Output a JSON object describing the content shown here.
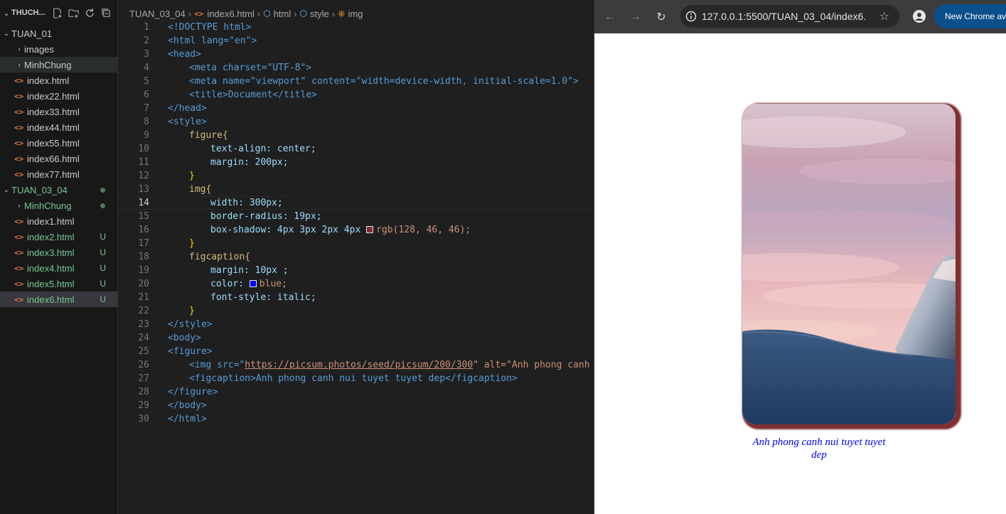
{
  "explorer": {
    "title": "THUCH...",
    "items": [
      {
        "label": "TUAN_01",
        "kind": "folder-open"
      },
      {
        "label": "images",
        "kind": "folder"
      },
      {
        "label": "MinhChung",
        "kind": "folder"
      },
      {
        "label": "index.html",
        "kind": "file"
      },
      {
        "label": "index22.html",
        "kind": "file"
      },
      {
        "label": "index33.html",
        "kind": "file"
      },
      {
        "label": "index44.html",
        "kind": "file"
      },
      {
        "label": "index55.html",
        "kind": "file"
      },
      {
        "label": "index66.html",
        "kind": "file"
      },
      {
        "label": "index77.html",
        "kind": "file"
      },
      {
        "label": "TUAN_03_04",
        "kind": "folder-open"
      },
      {
        "label": "MinhChung",
        "kind": "folder"
      },
      {
        "label": "index1.html",
        "kind": "file"
      },
      {
        "label": "index2.html",
        "kind": "file",
        "badge": "U"
      },
      {
        "label": "index3.html",
        "kind": "file",
        "badge": "U"
      },
      {
        "label": "index4.html",
        "kind": "file",
        "badge": "U"
      },
      {
        "label": "index5.html",
        "kind": "file",
        "badge": "U"
      },
      {
        "label": "index6.html",
        "kind": "file",
        "badge": "U"
      }
    ]
  },
  "breadcrumb": {
    "folder": "TUAN_03_04",
    "file": "index6.html",
    "n1": "html",
    "n2": "style",
    "n3": "img"
  },
  "code": {
    "lines": [
      "1",
      "2",
      "3",
      "4",
      "5",
      "6",
      "7",
      "8",
      "9",
      "10",
      "11",
      "12",
      "13",
      "14",
      "15",
      "16",
      "17",
      "18",
      "19",
      "20",
      "21",
      "22",
      "23",
      "24",
      "25",
      "26",
      "27",
      "28",
      "29",
      "30"
    ],
    "doctype": "<!DOCTYPE html>",
    "l2": "<html lang=\"en\">",
    "l3": "<head>",
    "l4": "<meta charset=\"UTF-8\">",
    "l5": "<meta name=\"viewport\" content=\"width=device-width, initial-scale=1.0\">",
    "l6": "<title>Document</title>",
    "l7": "</head>",
    "l8": "<style>",
    "l9": "figure{",
    "l10": "text-align: center;",
    "l11": "margin: 200px;",
    "l12": "}",
    "l13": "img{",
    "l14": "width: 300px;",
    "l15": "border-radius: 19px;",
    "l16a": "box-shadow: 4px 3px 2px 4px ",
    "l16b": "rgb(128, 46, 46);",
    "l17": "}",
    "l18": "figcaption{",
    "l19": "margin: 10px ;",
    "l20a": "color: ",
    "l20b": "blue;",
    "l21": "font-style: italic;",
    "l22": "}",
    "l23": "</style>",
    "l24": "<body>",
    "l25": "<figure>",
    "l26a": "<img src=\"",
    "l26url": "https://picsum.photos/seed/picsum/200/300",
    "l26b": "\" alt=\"Anh phong canh nu",
    "l27": "<figcaption>Anh phong canh nui tuyet tuyet dep</figcaption>",
    "l28": "</figure>",
    "l29": "</body>",
    "l30": "</html>"
  },
  "browser": {
    "url": "127.0.0.1:5500/TUAN_03_04/index6...",
    "chrome_button": "New Chrome ava",
    "caption": "Anh phong canh nui tuyet tuyet dep",
    "shadow_color": "#802e2e",
    "caption_color": "#0000ff"
  }
}
